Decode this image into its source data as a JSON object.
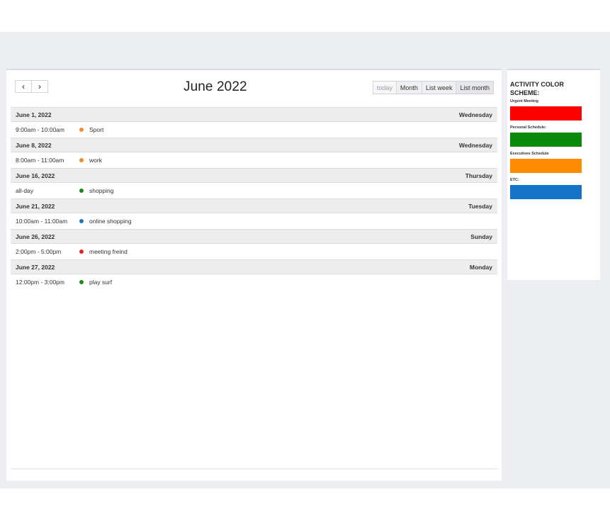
{
  "calendar": {
    "title": "June 2022",
    "nav": {
      "prev_icon": "‹",
      "next_icon": "›"
    },
    "views": [
      "today",
      "Month",
      "List week",
      "List month"
    ],
    "active_view": "List month",
    "days": [
      {
        "date": "June 1, 2022",
        "weekday": "Wednesday",
        "events": [
          {
            "time": "9:00am - 10:00am",
            "title": "Sport",
            "color": "#f28c28"
          }
        ]
      },
      {
        "date": "June 8, 2022",
        "weekday": "Wednesday",
        "events": [
          {
            "time": "8:00am - 11:00am",
            "title": "work",
            "color": "#f28c28"
          }
        ]
      },
      {
        "date": "June 16, 2022",
        "weekday": "Thursday",
        "events": [
          {
            "time": "all-day",
            "title": "shopping",
            "color": "#1a8a1a"
          }
        ]
      },
      {
        "date": "June 21, 2022",
        "weekday": "Tuesday",
        "events": [
          {
            "time": "10:00am - 11:00am",
            "title": "online shopping",
            "color": "#1f77c4"
          }
        ]
      },
      {
        "date": "June 26, 2022",
        "weekday": "Sunday",
        "events": [
          {
            "time": "2:00pm - 5:00pm",
            "title": "meeting freind",
            "color": "#e0261f"
          }
        ]
      },
      {
        "date": "June 27, 2022",
        "weekday": "Monday",
        "events": [
          {
            "time": "12:00pm - 3:00pm",
            "title": "play surf",
            "color": "#1a8a1a"
          }
        ]
      }
    ]
  },
  "legend": {
    "title": "ACTIVITY COLOR SCHEME:",
    "items": [
      {
        "label": "Urgent Meeting",
        "color": "#ff0000"
      },
      {
        "label": "Personal Schedule:",
        "color": "#0a8a0a"
      },
      {
        "label": "Executives Schedule",
        "color": "#ff8c00"
      },
      {
        "label": "ETC:",
        "color": "#1474c8"
      }
    ]
  }
}
